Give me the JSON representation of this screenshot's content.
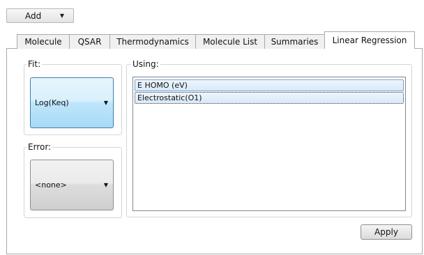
{
  "toolbar": {
    "add_label": "Add"
  },
  "tabs": [
    {
      "label": "Molecule"
    },
    {
      "label": "QSAR"
    },
    {
      "label": "Thermodynamics"
    },
    {
      "label": "Molecule List"
    },
    {
      "label": "Summaries"
    },
    {
      "label": "Linear Regression",
      "active": true
    }
  ],
  "fit": {
    "title": "Fit:",
    "value": "Log(Keq)"
  },
  "error": {
    "title": "Error:",
    "value": "<none>"
  },
  "using": {
    "title": "Using:",
    "items": [
      "E HOMO (eV)",
      "Electrostatic(O1)"
    ]
  },
  "apply_label": "Apply",
  "colors": {
    "selected_dropdown": "#bee6fd",
    "list_selection": "#d8e9f9",
    "border": "#a9a9a9"
  }
}
